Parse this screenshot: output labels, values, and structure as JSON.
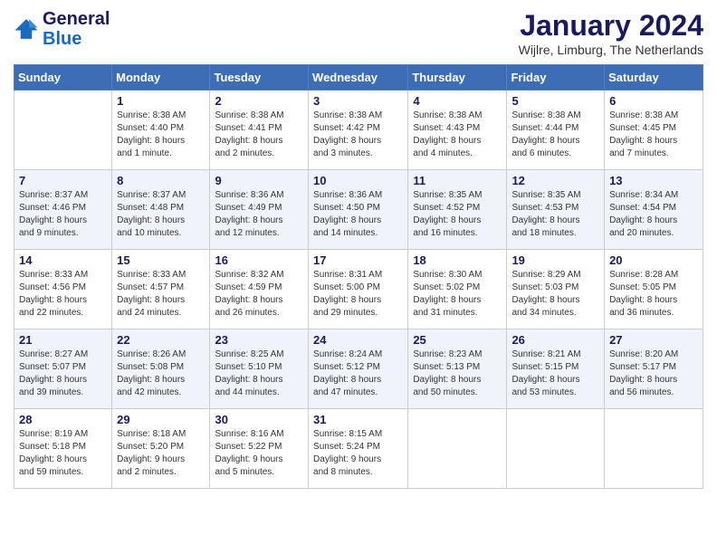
{
  "header": {
    "logo_line1": "General",
    "logo_line2": "Blue",
    "month": "January 2024",
    "location": "Wijlre, Limburg, The Netherlands"
  },
  "weekdays": [
    "Sunday",
    "Monday",
    "Tuesday",
    "Wednesday",
    "Thursday",
    "Friday",
    "Saturday"
  ],
  "weeks": [
    [
      {
        "num": "",
        "info": ""
      },
      {
        "num": "1",
        "info": "Sunrise: 8:38 AM\nSunset: 4:40 PM\nDaylight: 8 hours\nand 1 minute."
      },
      {
        "num": "2",
        "info": "Sunrise: 8:38 AM\nSunset: 4:41 PM\nDaylight: 8 hours\nand 2 minutes."
      },
      {
        "num": "3",
        "info": "Sunrise: 8:38 AM\nSunset: 4:42 PM\nDaylight: 8 hours\nand 3 minutes."
      },
      {
        "num": "4",
        "info": "Sunrise: 8:38 AM\nSunset: 4:43 PM\nDaylight: 8 hours\nand 4 minutes."
      },
      {
        "num": "5",
        "info": "Sunrise: 8:38 AM\nSunset: 4:44 PM\nDaylight: 8 hours\nand 6 minutes."
      },
      {
        "num": "6",
        "info": "Sunrise: 8:38 AM\nSunset: 4:45 PM\nDaylight: 8 hours\nand 7 minutes."
      }
    ],
    [
      {
        "num": "7",
        "info": "Sunrise: 8:37 AM\nSunset: 4:46 PM\nDaylight: 8 hours\nand 9 minutes."
      },
      {
        "num": "8",
        "info": "Sunrise: 8:37 AM\nSunset: 4:48 PM\nDaylight: 8 hours\nand 10 minutes."
      },
      {
        "num": "9",
        "info": "Sunrise: 8:36 AM\nSunset: 4:49 PM\nDaylight: 8 hours\nand 12 minutes."
      },
      {
        "num": "10",
        "info": "Sunrise: 8:36 AM\nSunset: 4:50 PM\nDaylight: 8 hours\nand 14 minutes."
      },
      {
        "num": "11",
        "info": "Sunrise: 8:35 AM\nSunset: 4:52 PM\nDaylight: 8 hours\nand 16 minutes."
      },
      {
        "num": "12",
        "info": "Sunrise: 8:35 AM\nSunset: 4:53 PM\nDaylight: 8 hours\nand 18 minutes."
      },
      {
        "num": "13",
        "info": "Sunrise: 8:34 AM\nSunset: 4:54 PM\nDaylight: 8 hours\nand 20 minutes."
      }
    ],
    [
      {
        "num": "14",
        "info": "Sunrise: 8:33 AM\nSunset: 4:56 PM\nDaylight: 8 hours\nand 22 minutes."
      },
      {
        "num": "15",
        "info": "Sunrise: 8:33 AM\nSunset: 4:57 PM\nDaylight: 8 hours\nand 24 minutes."
      },
      {
        "num": "16",
        "info": "Sunrise: 8:32 AM\nSunset: 4:59 PM\nDaylight: 8 hours\nand 26 minutes."
      },
      {
        "num": "17",
        "info": "Sunrise: 8:31 AM\nSunset: 5:00 PM\nDaylight: 8 hours\nand 29 minutes."
      },
      {
        "num": "18",
        "info": "Sunrise: 8:30 AM\nSunset: 5:02 PM\nDaylight: 8 hours\nand 31 minutes."
      },
      {
        "num": "19",
        "info": "Sunrise: 8:29 AM\nSunset: 5:03 PM\nDaylight: 8 hours\nand 34 minutes."
      },
      {
        "num": "20",
        "info": "Sunrise: 8:28 AM\nSunset: 5:05 PM\nDaylight: 8 hours\nand 36 minutes."
      }
    ],
    [
      {
        "num": "21",
        "info": "Sunrise: 8:27 AM\nSunset: 5:07 PM\nDaylight: 8 hours\nand 39 minutes."
      },
      {
        "num": "22",
        "info": "Sunrise: 8:26 AM\nSunset: 5:08 PM\nDaylight: 8 hours\nand 42 minutes."
      },
      {
        "num": "23",
        "info": "Sunrise: 8:25 AM\nSunset: 5:10 PM\nDaylight: 8 hours\nand 44 minutes."
      },
      {
        "num": "24",
        "info": "Sunrise: 8:24 AM\nSunset: 5:12 PM\nDaylight: 8 hours\nand 47 minutes."
      },
      {
        "num": "25",
        "info": "Sunrise: 8:23 AM\nSunset: 5:13 PM\nDaylight: 8 hours\nand 50 minutes."
      },
      {
        "num": "26",
        "info": "Sunrise: 8:21 AM\nSunset: 5:15 PM\nDaylight: 8 hours\nand 53 minutes."
      },
      {
        "num": "27",
        "info": "Sunrise: 8:20 AM\nSunset: 5:17 PM\nDaylight: 8 hours\nand 56 minutes."
      }
    ],
    [
      {
        "num": "28",
        "info": "Sunrise: 8:19 AM\nSunset: 5:18 PM\nDaylight: 8 hours\nand 59 minutes."
      },
      {
        "num": "29",
        "info": "Sunrise: 8:18 AM\nSunset: 5:20 PM\nDaylight: 9 hours\nand 2 minutes."
      },
      {
        "num": "30",
        "info": "Sunrise: 8:16 AM\nSunset: 5:22 PM\nDaylight: 9 hours\nand 5 minutes."
      },
      {
        "num": "31",
        "info": "Sunrise: 8:15 AM\nSunset: 5:24 PM\nDaylight: 9 hours\nand 8 minutes."
      },
      {
        "num": "",
        "info": ""
      },
      {
        "num": "",
        "info": ""
      },
      {
        "num": "",
        "info": ""
      }
    ]
  ]
}
